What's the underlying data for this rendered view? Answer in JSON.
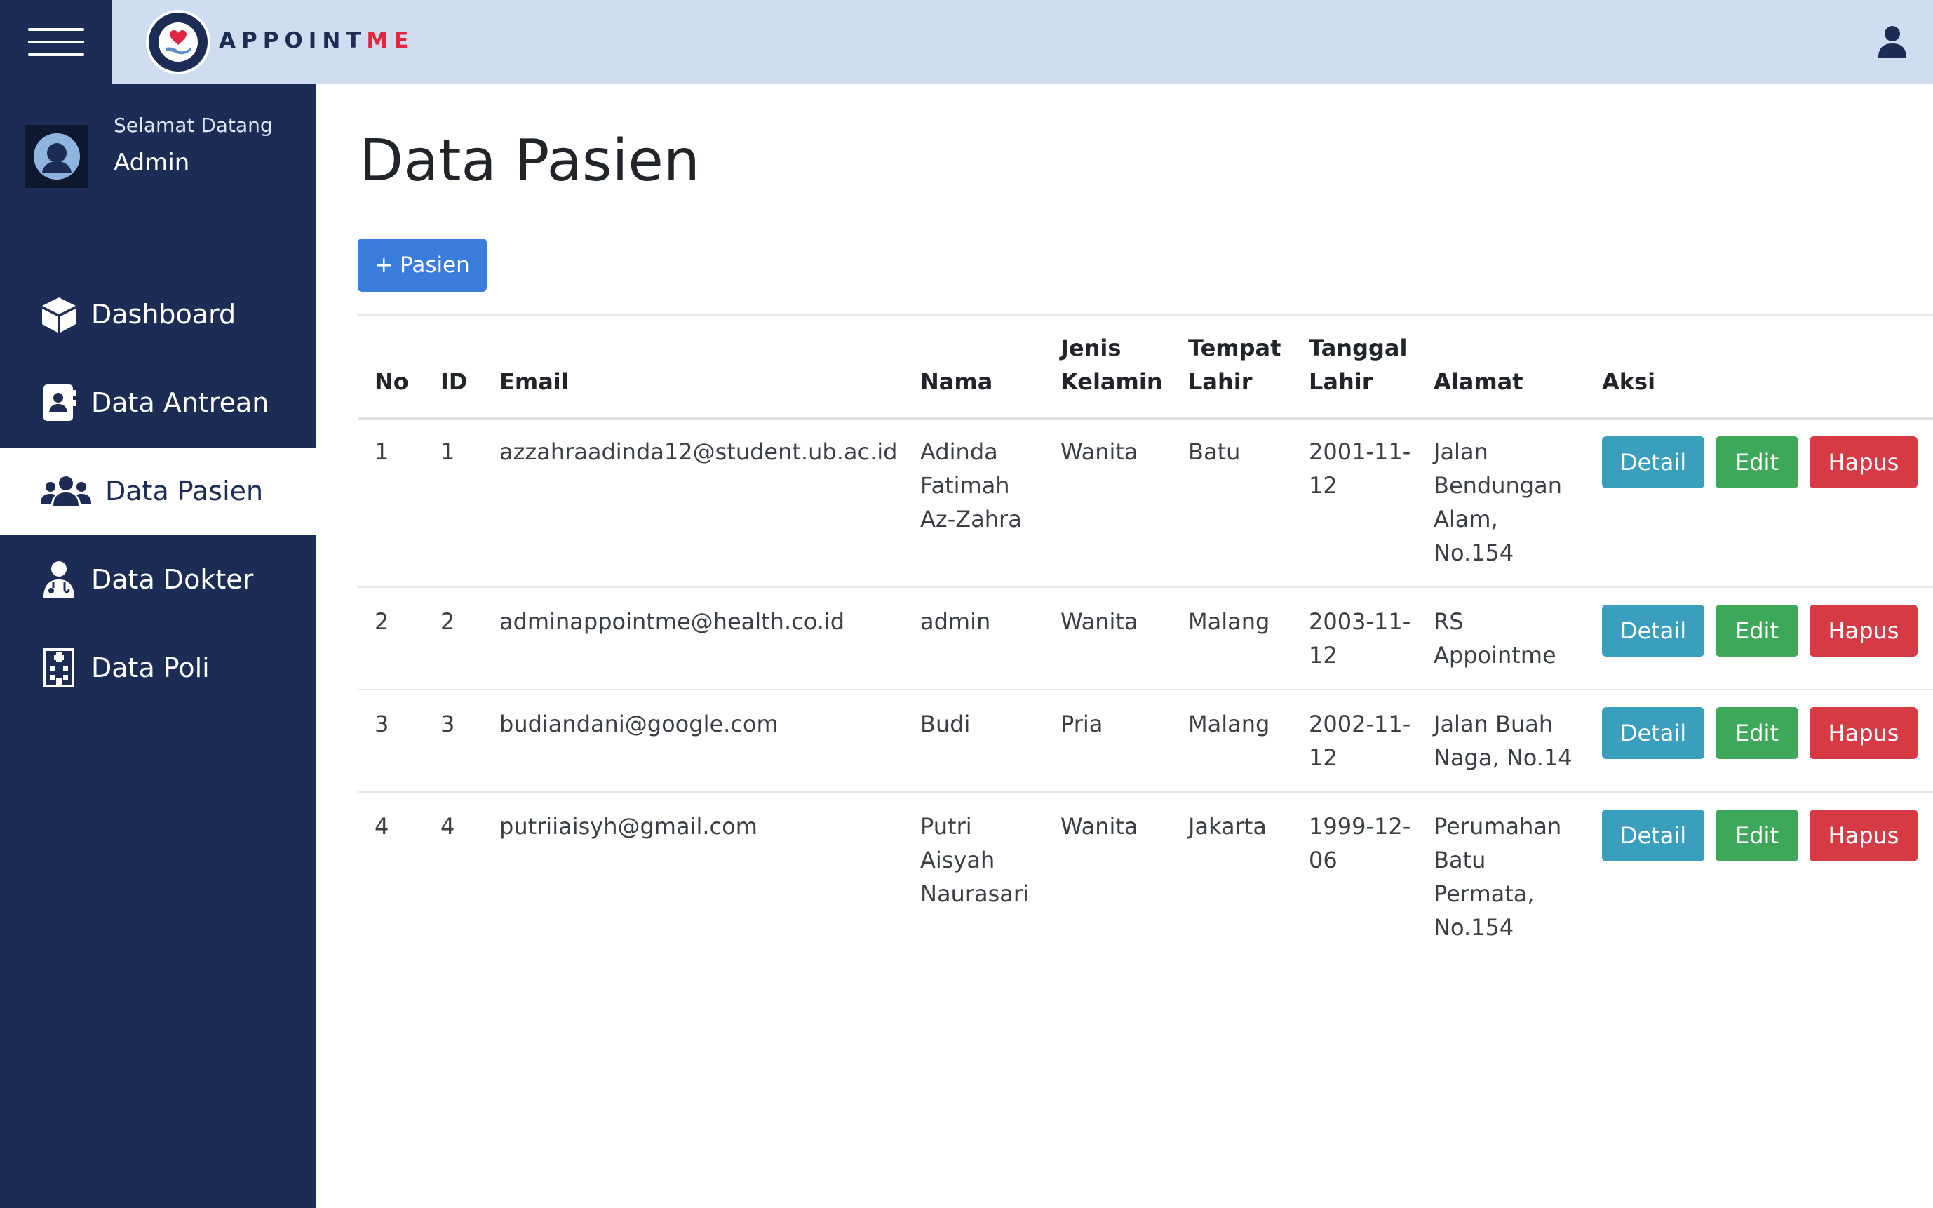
{
  "topbar": {
    "brand_main": "APPOINT",
    "brand_accent": "ME",
    "colors": {
      "bar": "#d0dcf0",
      "accent": "#e3263f",
      "navy": "#1c2c55"
    }
  },
  "sidebar": {
    "greeting": "Selamat Datang",
    "user_name": "Admin",
    "items": [
      {
        "label": "Dashboard",
        "icon": "cube-icon"
      },
      {
        "label": "Data Antrean",
        "icon": "contact-book-icon"
      },
      {
        "label": "Data Pasien",
        "icon": "users-icon",
        "active": true
      },
      {
        "label": "Data Dokter",
        "icon": "doctor-icon"
      },
      {
        "label": "Data Poli",
        "icon": "hospital-building-icon"
      }
    ]
  },
  "main": {
    "title": "Data Pasien",
    "add_button": "+ Pasien",
    "table": {
      "headers": {
        "no": "No",
        "id": "ID",
        "email": "Email",
        "nama": "Nama",
        "jk_1": "Jenis",
        "jk_2": "Kelamin",
        "tl_1": "Tempat",
        "tl_2": "Lahir",
        "tgl_1": "Tanggal",
        "tgl_2": "Lahir",
        "alamat": "Alamat",
        "aksi": "Aksi"
      },
      "rows": [
        {
          "no": "1",
          "id": "1",
          "email": "azzahraadinda12@student.ub.ac.id",
          "nama": [
            "Adinda",
            "Fatimah",
            "Az-Zahra"
          ],
          "jk": "Wanita",
          "tempat": "Batu",
          "tanggal": [
            "2001-11-",
            "12"
          ],
          "alamat": [
            "Jalan",
            "Bendungan",
            "Alam,",
            "No.154"
          ]
        },
        {
          "no": "2",
          "id": "2",
          "email": "adminappointme@health.co.id",
          "nama": [
            "admin"
          ],
          "jk": "Wanita",
          "tempat": "Malang",
          "tanggal": [
            "2003-11-",
            "12"
          ],
          "alamat": [
            "RS",
            "Appointme"
          ]
        },
        {
          "no": "3",
          "id": "3",
          "email": "budiandani@google.com",
          "nama": [
            "Budi"
          ],
          "jk": "Pria",
          "tempat": "Malang",
          "tanggal": [
            "2002-11-",
            "12"
          ],
          "alamat": [
            "Jalan Buah",
            "Naga, No.14"
          ]
        },
        {
          "no": "4",
          "id": "4",
          "email": "putriiaisyh@gmail.com",
          "nama": [
            "Putri",
            "Aisyah",
            "Naurasari"
          ],
          "jk": "Wanita",
          "tempat": "Jakarta",
          "tanggal": [
            "1999-12-",
            "06"
          ],
          "alamat": [
            "Perumahan",
            "Batu",
            "Permata,",
            "No.154"
          ]
        }
      ],
      "actions": {
        "detail": "Detail",
        "edit": "Edit",
        "hapus": "Hapus"
      }
    }
  }
}
